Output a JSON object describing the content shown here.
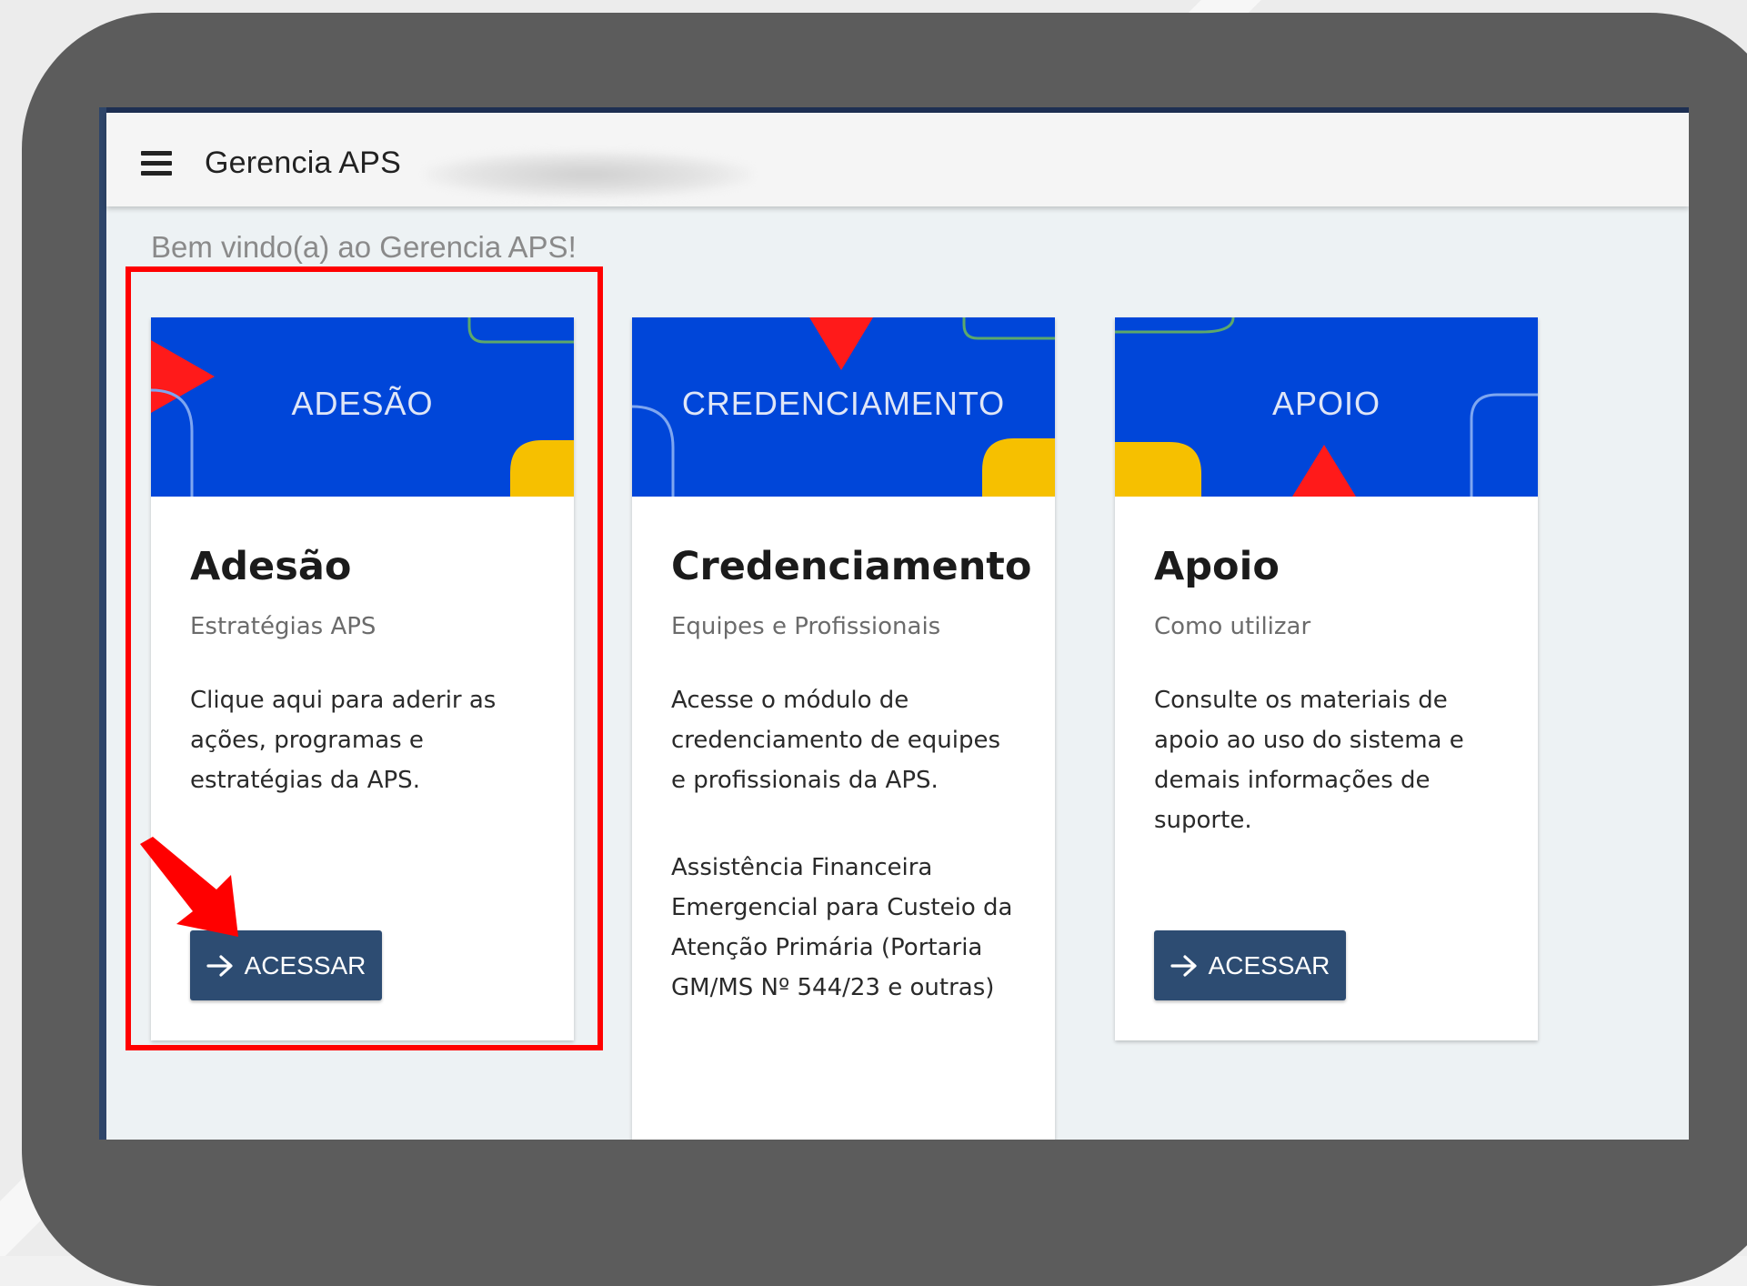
{
  "app": {
    "title": "Gerencia APS",
    "welcome": "Bem vindo(a) ao Gerencia APS!"
  },
  "colors": {
    "header_blue": "#0046d9",
    "button_blue": "#2d4c72",
    "accent_red": "#ff0000",
    "accent_yellow": "#f6c000",
    "frame_gray": "#5c5c5c"
  },
  "cards": [
    {
      "banner": "ADESÃO",
      "title": "Adesão",
      "subtitle": "Estratégias APS",
      "text": "Clique aqui para aderir as ações, programas e estratégias da APS.",
      "button": "ACESSAR"
    },
    {
      "banner": "CREDENCIAMENTO",
      "title": "Credenciamento",
      "subtitle": "Equipes e Profissionais",
      "text": "Acesse o módulo de credenciamento de equipes e profissionais da APS.",
      "text2": "Assistência Financeira Emergencial para Custeio da Atenção Primária (Portaria GM/MS Nº 544/23 e outras)"
    },
    {
      "banner": "APOIO",
      "title": "Apoio",
      "subtitle": "Como utilizar",
      "text": "Consulte os materiais de apoio ao uso do sistema e demais informações de suporte.",
      "button": "ACESSAR"
    }
  ],
  "icons": {
    "menu": "hamburger-menu-icon",
    "button": "arrow-right-icon",
    "annotation": "red-pointer-arrow"
  }
}
